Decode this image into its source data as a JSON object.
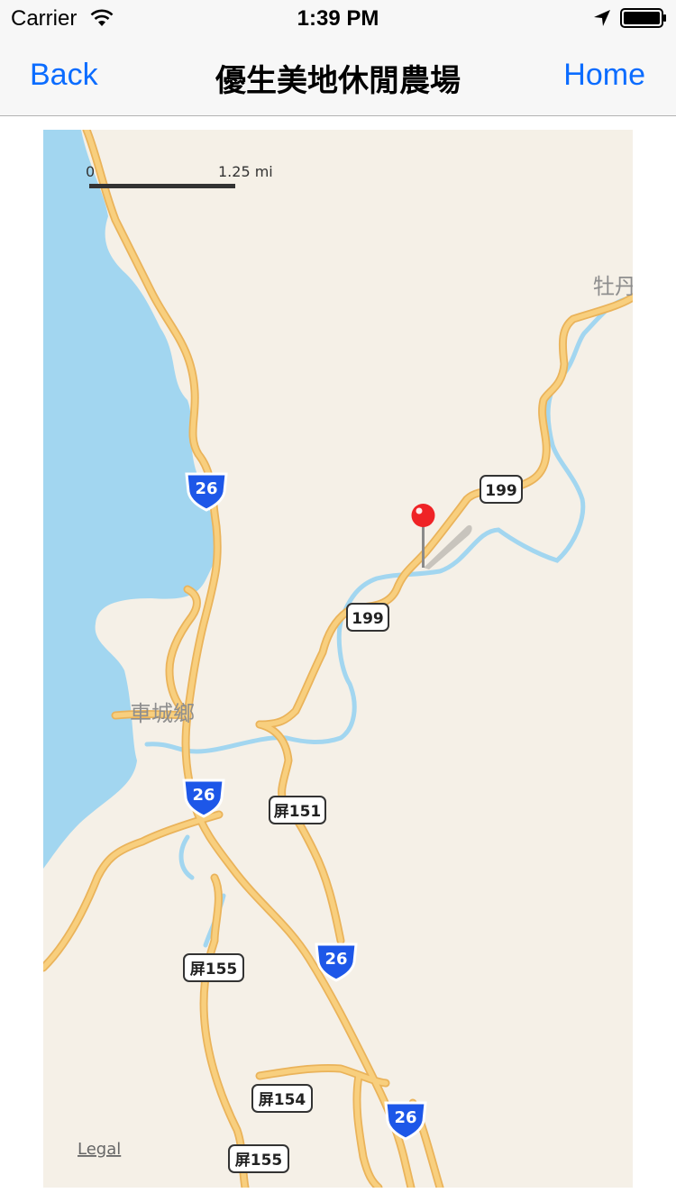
{
  "status_bar": {
    "carrier": "Carrier",
    "time": "1:39 PM"
  },
  "nav": {
    "back_label": "Back",
    "title": "優生美地休閒農場",
    "home_label": "Home"
  },
  "map": {
    "scale": {
      "start": "0",
      "end": "1.25 mi"
    },
    "place_labels": [
      "牡丹",
      "車城鄉"
    ],
    "route_shields": [
      "26",
      "26",
      "26",
      "26"
    ],
    "route_badges": [
      "199",
      "199",
      "屏151",
      "屏155",
      "屏154",
      "屏155"
    ],
    "legal_link": "Legal",
    "colors": {
      "water": "#a2d6f0",
      "land": "#f5f0e7",
      "road": "#f8cf7e",
      "pin": "#ef2326",
      "accent": "#0b6cff"
    }
  }
}
